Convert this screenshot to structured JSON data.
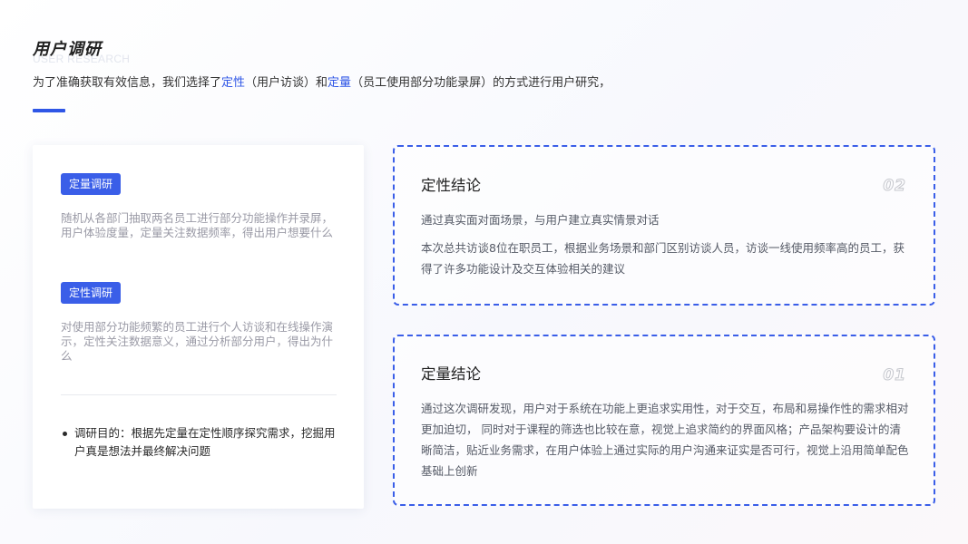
{
  "header": {
    "title": "用户调研",
    "subtitle": "USER RESEARCH"
  },
  "intro": {
    "before": "为了准确获取有效信息，我们选择了",
    "hl1": "定性",
    "middle1": "（用户访谈）和",
    "hl2": "定量",
    "after": "（员工使用部分功能录屏）的方式进行用户研究，"
  },
  "colors": {
    "accent": "#2f56e6"
  },
  "left_card": {
    "tag1": "定量调研",
    "desc1": "随机从各部门抽取两名员工进行部分功能操作并录屏，用户体验度量，定量关注数据频率，得出用户想要什么",
    "tag2": "定性调研",
    "desc2": "对使用部分功能频繁的员工进行个人访谈和在线操作演示，定性关注数据意义，通过分析部分用户，得出为什么",
    "bullet": "调研目的：根据先定量在定性顺序探究需求，挖掘用户真是想法并最终解决问题"
  },
  "qualitative": {
    "title": "定性结论",
    "num": "02",
    "text1": "通过真实面对面场景，与用户建立真实情景对话",
    "text2": "本次总共访谈8位在职员工，根据业务场景和部门区别访谈人员，访谈一线使用频率高的员工，获得了许多功能设计及交互体验相关的建议"
  },
  "quantitative": {
    "title": "定量结论",
    "num": "01",
    "text": "通过这次调研发现，用户对于系统在功能上更追求实用性，对于交互，布局和易操作性的需求相对更加迫切， 同时对于课程的筛选也比较在意，视觉上追求简约的界面风格；产品架构要设计的清晰简洁，贴近业务需求，在用户体验上通过实际的用户沟通来证实是否可行，视觉上沿用简单配色基础上创新"
  }
}
